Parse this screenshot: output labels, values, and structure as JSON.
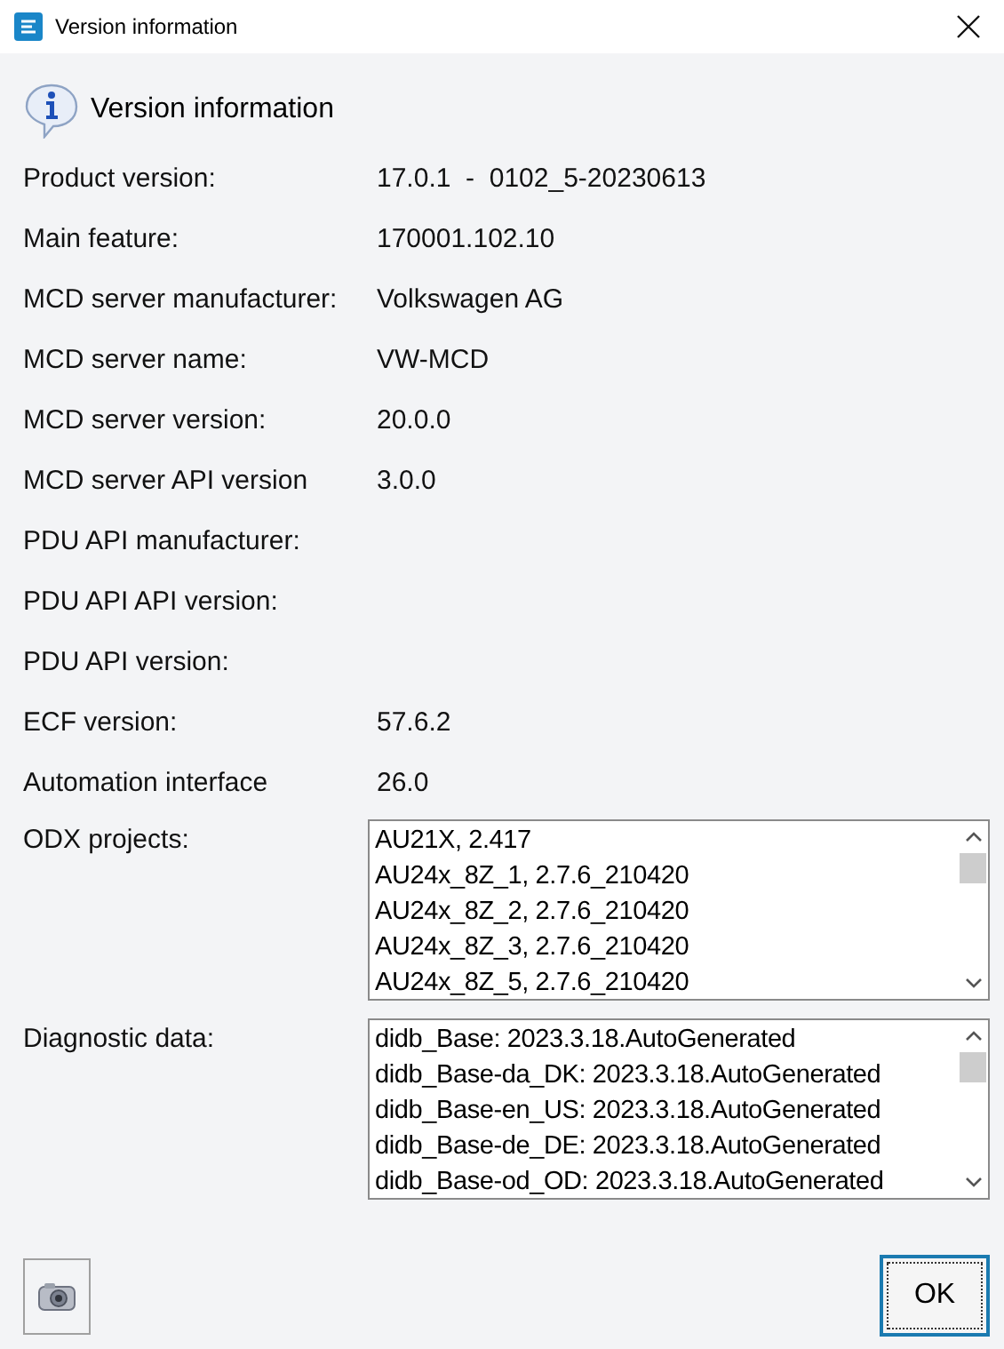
{
  "window": {
    "title": "Version information"
  },
  "header": "Version information",
  "fields": [
    {
      "label": "Product version:",
      "value": "17.0.1  -  0102_5-20230613"
    },
    {
      "label": "Main feature:",
      "value": "170001.102.10"
    },
    {
      "label": "MCD server manufacturer:",
      "value": "Volkswagen AG"
    },
    {
      "label": "MCD server name:",
      "value": "VW-MCD"
    },
    {
      "label": "MCD server version:",
      "value": "20.0.0"
    },
    {
      "label": "MCD server API version",
      "value": "3.0.0"
    },
    {
      "label": "PDU API manufacturer:"
    },
    {
      "label": "PDU API API version:"
    },
    {
      "label": "PDU API version:"
    },
    {
      "label": "ECF version:",
      "value": "57.6.2"
    },
    {
      "label": "Automation interface",
      "value": "26.0"
    }
  ],
  "lists": [
    {
      "label": "ODX projects:",
      "items": [
        "AU21X, 2.417",
        "AU24x_8Z_1, 2.7.6_210420",
        "AU24x_8Z_2, 2.7.6_210420",
        "AU24x_8Z_3, 2.7.6_210420",
        "AU24x_8Z_5, 2.7.6_210420"
      ]
    },
    {
      "label": "Diagnostic data:",
      "items": [
        "didb_Base: 2023.3.18.AutoGenerated",
        "didb_Base-da_DK: 2023.3.18.AutoGenerated",
        "didb_Base-en_US: 2023.3.18.AutoGenerated",
        "didb_Base-de_DE: 2023.3.18.AutoGenerated",
        "didb_Base-od_OD: 2023.3.18.AutoGenerated"
      ]
    }
  ],
  "ok_button": "OK"
}
